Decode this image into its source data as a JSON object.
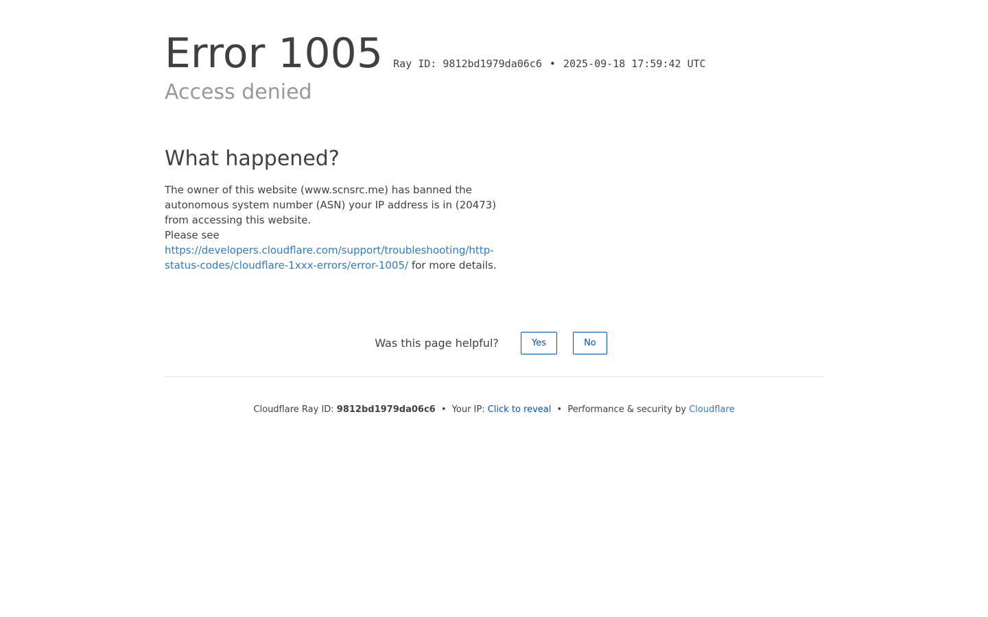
{
  "error": {
    "title": "Error 1005",
    "ray_label": "Ray ID: 9812bd1979da06c6",
    "separator": "•",
    "timestamp": "2025-09-18 17:59:42 UTC",
    "subtitle": "Access denied"
  },
  "what_happened": {
    "heading": "What happened?",
    "text": "The owner of this website (www.scnsrc.me) has banned the autonomous system number (ASN) your IP address is in (20473) from accessing this website.",
    "please_see": "Please see",
    "link_text": "https://developers.cloudflare.com/support/troubleshooting/http-status-codes/cloudflare-1xxx-errors/error-1005/",
    "after_link": " for more details."
  },
  "feedback": {
    "question": "Was this page helpful?",
    "yes_label": "Yes",
    "no_label": "No"
  },
  "footer": {
    "ray_prefix": "Cloudflare Ray ID: ",
    "ray_id": "9812bd1979da06c6",
    "separator": "•",
    "ip_prefix": "Your IP: ",
    "ip_reveal": "Click to reveal",
    "perf_prefix": "Performance & security by ",
    "cloudflare_link": "Cloudflare"
  },
  "colors": {
    "text": "#404040",
    "muted": "#999999",
    "link": "#2f7bbf",
    "button": "#0051c3",
    "divider": "#e8e8e8"
  }
}
